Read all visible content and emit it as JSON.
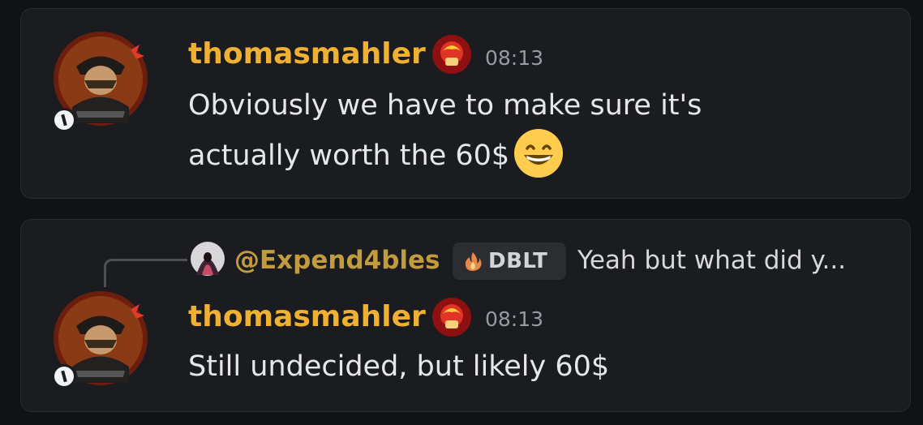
{
  "messages": [
    {
      "author": "thomasmahler",
      "timestamp": "08:13",
      "lines": [
        "Obviously we have to make sure it's",
        "actually worth the 60$"
      ],
      "emoji": "grinning-face-emoji"
    },
    {
      "reply": {
        "author": "@Expend4bles",
        "tag": "DBLT",
        "preview": "Yeah but what did y..."
      },
      "author": "thomasmahler",
      "timestamp": "08:13",
      "lines": [
        "Still undecided, but likely 60$"
      ]
    }
  ],
  "colors": {
    "background": "#111214",
    "card": "#1b1c20",
    "username": "#f0b132",
    "reply_username": "#c29b3f",
    "timestamp": "#949ba4",
    "text": "#e6e7ea"
  },
  "icons": {
    "avatar": "pirate-avatar",
    "role": "red-role-badge-icon",
    "tag": "flame-tag-icon",
    "reply_avatar": "hooded-figure-avatar"
  }
}
